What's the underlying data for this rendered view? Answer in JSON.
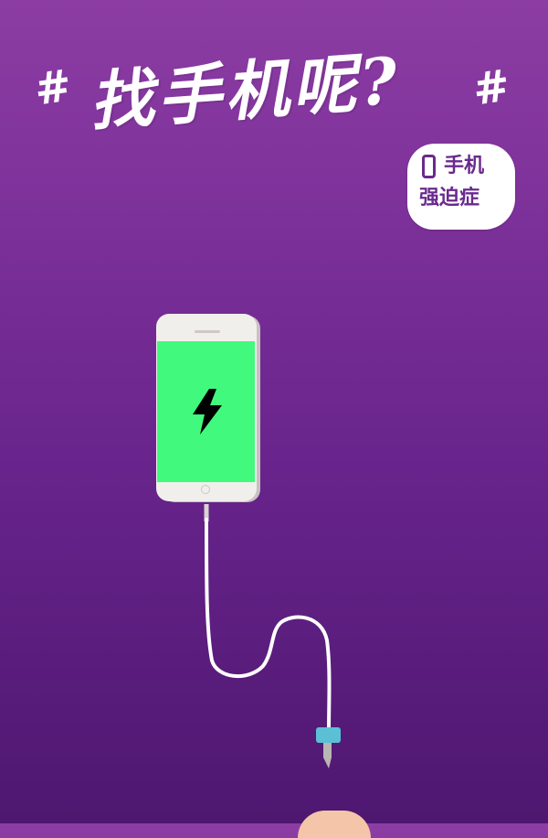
{
  "headline": {
    "hash_left": "#",
    "text": "找手机呢?",
    "hash_right": "#"
  },
  "badge": {
    "icon": "phone-outline-icon",
    "line1": "手机",
    "line2": "强迫症"
  },
  "phone": {
    "screen_color": "#41f97d",
    "icon": "charging-bolt-icon",
    "cable_connector_color": "#5bbfd6"
  },
  "colors": {
    "background_top": "#8c3da3",
    "background_bottom": "#4e1770",
    "badge_text": "#6a2a8e"
  }
}
